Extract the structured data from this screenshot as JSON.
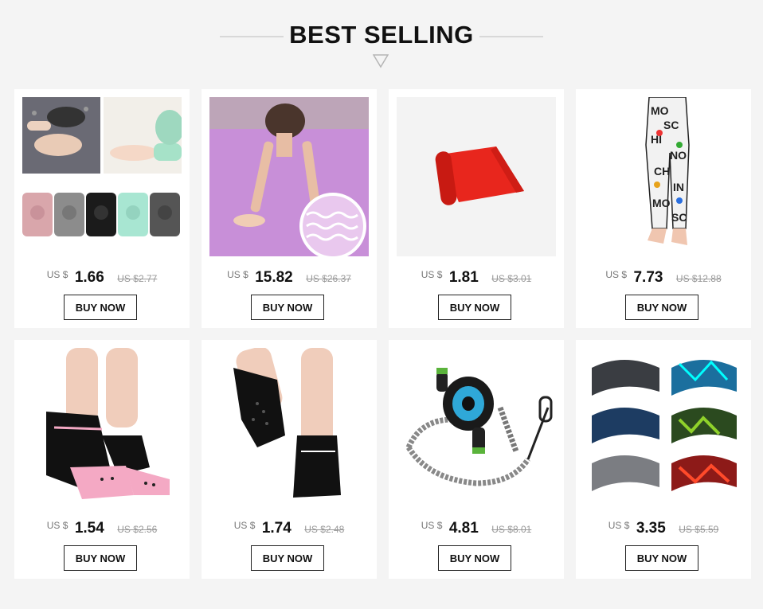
{
  "section_title": "BEST SELLING",
  "currency_label": "US $",
  "buy_label": "BUY NOW",
  "products": [
    {
      "price": "1.66",
      "old_price": "US $2.77",
      "image": "baby-knee-pads"
    },
    {
      "price": "15.82",
      "old_price": "US $26.37",
      "image": "yoga-mat"
    },
    {
      "price": "1.81",
      "old_price": "US $3.01",
      "image": "resistance-band"
    },
    {
      "price": "7.73",
      "old_price": "US $12.88",
      "image": "printed-leggings"
    },
    {
      "price": "1.54",
      "old_price": "US $2.56",
      "image": "cat-yoga-socks"
    },
    {
      "price": "1.74",
      "old_price": "US $2.48",
      "image": "black-yoga-socks"
    },
    {
      "price": "4.81",
      "old_price": "US $8.01",
      "image": "ab-wheel-roller"
    },
    {
      "price": "3.35",
      "old_price": "US $5.59",
      "image": "sport-headbands"
    }
  ]
}
